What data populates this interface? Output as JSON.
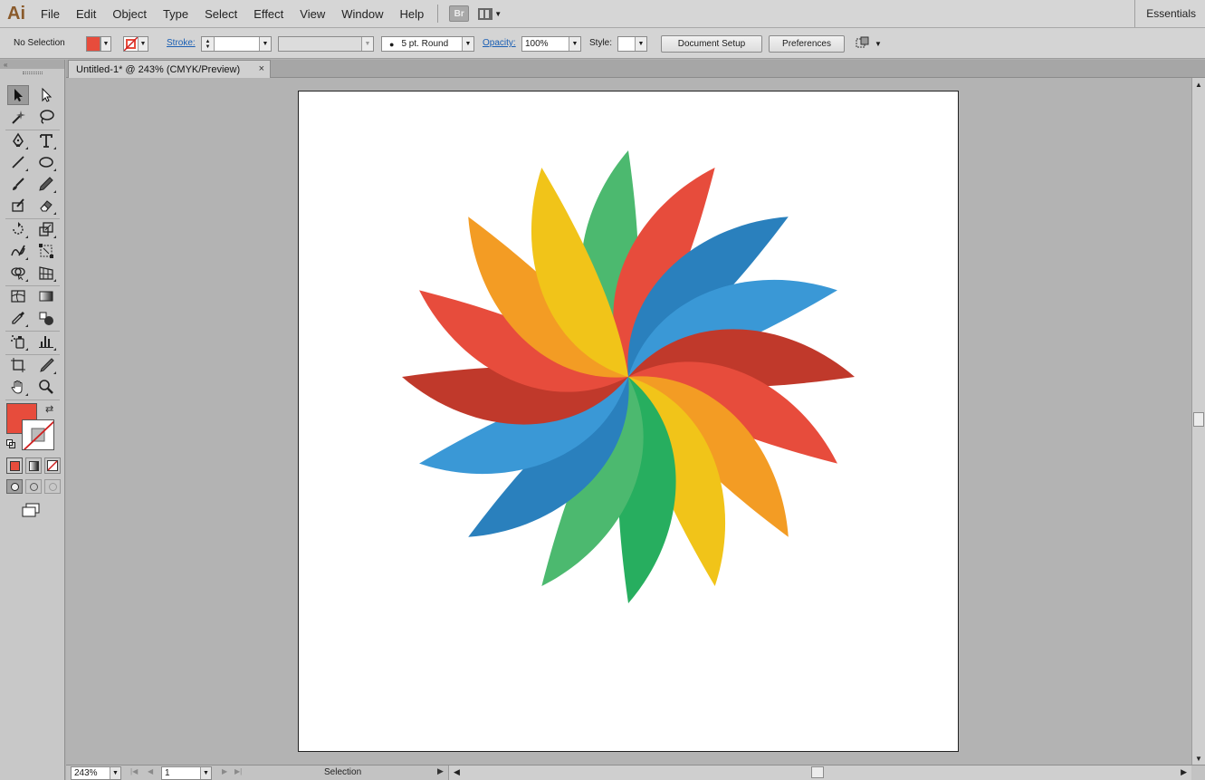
{
  "app": {
    "logo": "Ai",
    "workspace": "Essentials",
    "bridge_label": "Br"
  },
  "menu": [
    "File",
    "Edit",
    "Object",
    "Type",
    "Select",
    "Effect",
    "View",
    "Window",
    "Help"
  ],
  "control_bar": {
    "selection": "No Selection",
    "fill_color": "#e74c3c",
    "stroke_label": "Stroke:",
    "brush": "5 pt. Round",
    "opacity_label": "Opacity:",
    "opacity_value": "100%",
    "style_label": "Style:",
    "document_setup": "Document Setup",
    "preferences": "Preferences"
  },
  "document": {
    "tab_title": "Untitled-1* @ 243% (CMYK/Preview)",
    "close": "×"
  },
  "tools": {
    "fill_color": "#e74c3c",
    "icons": [
      "selection-tool-icon",
      "direct-selection-tool-icon",
      "magic-wand-tool-icon",
      "lasso-tool-icon",
      "pen-tool-icon",
      "type-tool-icon",
      "line-tool-icon",
      "ellipse-tool-icon",
      "paintbrush-tool-icon",
      "pencil-tool-icon",
      "blob-brush-tool-icon",
      "eraser-tool-icon",
      "rotate-tool-icon",
      "scale-tool-icon",
      "warp-tool-icon",
      "free-transform-tool-icon",
      "shape-builder-tool-icon",
      "perspective-grid-tool-icon",
      "mesh-tool-icon",
      "gradient-tool-icon",
      "eyedropper-tool-icon",
      "blend-tool-icon",
      "symbol-sprayer-tool-icon",
      "column-graph-tool-icon",
      "artboard-tool-icon",
      "slice-tool-icon",
      "hand-tool-icon",
      "zoom-tool-icon"
    ]
  },
  "artwork": {
    "petal_colors": [
      "#4cb96f",
      "#e74c3c",
      "#2a80bd",
      "#3a98d6",
      "#c0392b",
      "#e74c3c",
      "#f39c24",
      "#f1c419",
      "#27ae5f",
      "#4cb96f",
      "#2a80bd",
      "#3a98d6",
      "#c0392b",
      "#e74c3c",
      "#f39c24",
      "#f1c419"
    ]
  },
  "status_bar": {
    "zoom": "243%",
    "artboard": "1",
    "tool": "Selection"
  }
}
